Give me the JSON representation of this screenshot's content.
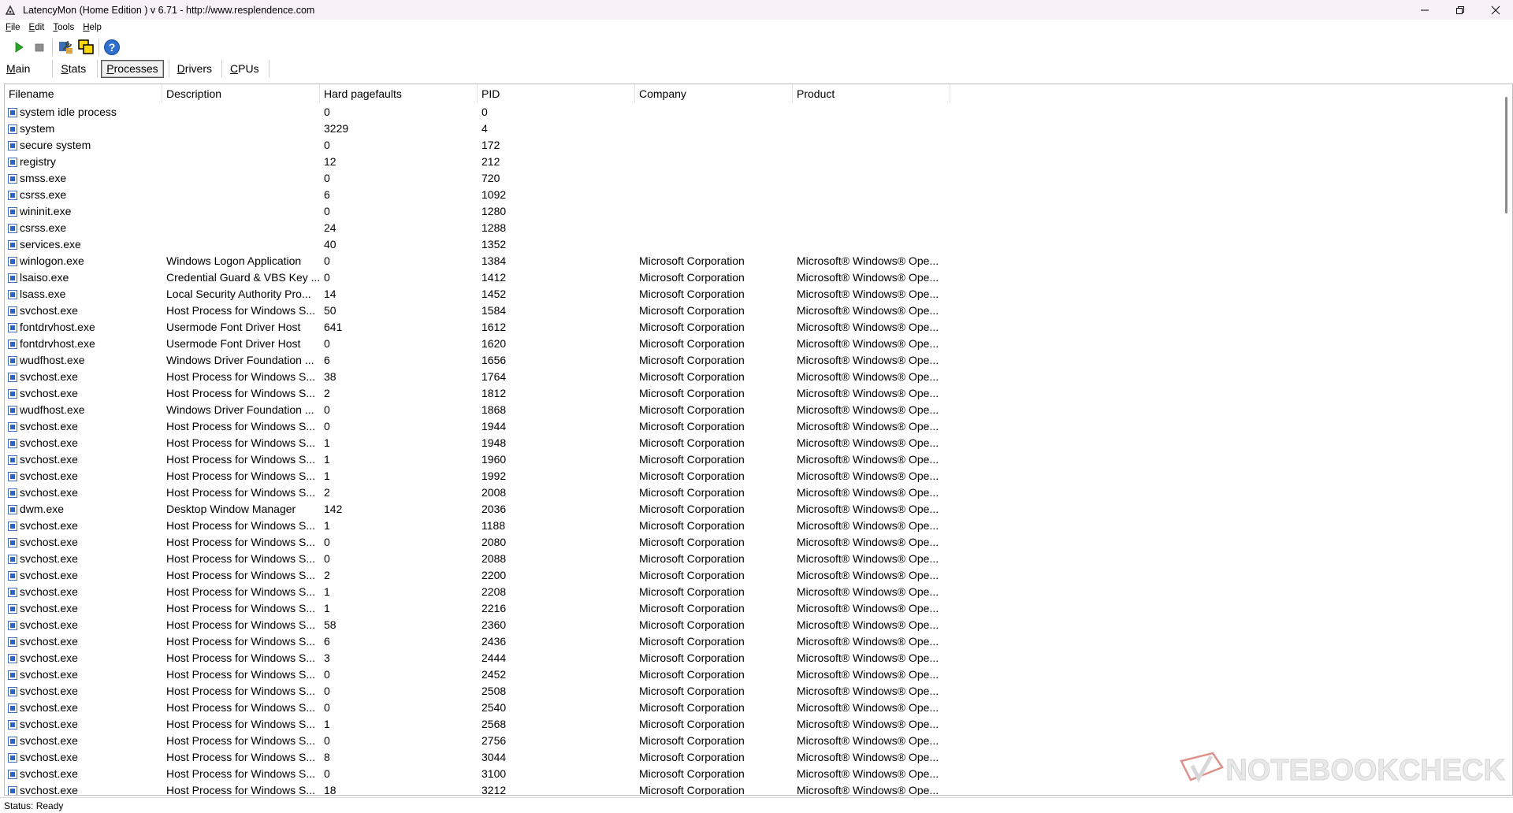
{
  "window": {
    "title": "LatencyMon  (Home Edition )  v 6.71 - http://www.resplendence.com"
  },
  "menu": [
    {
      "label": "File",
      "underline": "F",
      "rest": "ile"
    },
    {
      "label": "Edit",
      "underline": "E",
      "rest": "dit"
    },
    {
      "label": "Tools",
      "underline": "T",
      "rest": "ools"
    },
    {
      "label": "Help",
      "underline": "H",
      "rest": "elp"
    }
  ],
  "toolbar": {
    "icons": [
      "play-icon",
      "stop-icon",
      "wrench-icon",
      "windows-icon",
      "help-icon"
    ]
  },
  "tabs": [
    {
      "first": "M",
      "rest": "ain",
      "active": false
    },
    {
      "first": "S",
      "rest": "tats",
      "active": false
    },
    {
      "first": "P",
      "rest": "rocesses",
      "active": true
    },
    {
      "first": "D",
      "rest": "rivers",
      "active": false
    },
    {
      "first": "C",
      "rest": "PUs",
      "active": false
    }
  ],
  "table": {
    "columns": [
      "Filename",
      "Description",
      "Hard pagefaults",
      "PID",
      "Company",
      "Product"
    ],
    "rows": [
      [
        "system idle process",
        "",
        "0",
        "0",
        "",
        ""
      ],
      [
        "system",
        "",
        "3229",
        "4",
        "",
        ""
      ],
      [
        "secure system",
        "",
        "0",
        "172",
        "",
        ""
      ],
      [
        "registry",
        "",
        "12",
        "212",
        "",
        ""
      ],
      [
        "smss.exe",
        "",
        "0",
        "720",
        "",
        ""
      ],
      [
        "csrss.exe",
        "",
        "6",
        "1092",
        "",
        ""
      ],
      [
        "wininit.exe",
        "",
        "0",
        "1280",
        "",
        ""
      ],
      [
        "csrss.exe",
        "",
        "24",
        "1288",
        "",
        ""
      ],
      [
        "services.exe",
        "",
        "40",
        "1352",
        "",
        ""
      ],
      [
        "winlogon.exe",
        "Windows Logon Application",
        "0",
        "1384",
        "Microsoft Corporation",
        "Microsoft® Windows® Ope..."
      ],
      [
        "lsaiso.exe",
        "Credential Guard & VBS Key ...",
        "0",
        "1412",
        "Microsoft Corporation",
        "Microsoft® Windows® Ope..."
      ],
      [
        "lsass.exe",
        "Local Security Authority Pro...",
        "14",
        "1452",
        "Microsoft Corporation",
        "Microsoft® Windows® Ope..."
      ],
      [
        "svchost.exe",
        "Host Process for Windows S...",
        "50",
        "1584",
        "Microsoft Corporation",
        "Microsoft® Windows® Ope..."
      ],
      [
        "fontdrvhost.exe",
        "Usermode Font Driver Host",
        "641",
        "1612",
        "Microsoft Corporation",
        "Microsoft® Windows® Ope..."
      ],
      [
        "fontdrvhost.exe",
        "Usermode Font Driver Host",
        "0",
        "1620",
        "Microsoft Corporation",
        "Microsoft® Windows® Ope..."
      ],
      [
        "wudfhost.exe",
        "Windows Driver Foundation ...",
        "6",
        "1656",
        "Microsoft Corporation",
        "Microsoft® Windows® Ope..."
      ],
      [
        "svchost.exe",
        "Host Process for Windows S...",
        "38",
        "1764",
        "Microsoft Corporation",
        "Microsoft® Windows® Ope..."
      ],
      [
        "svchost.exe",
        "Host Process for Windows S...",
        "2",
        "1812",
        "Microsoft Corporation",
        "Microsoft® Windows® Ope..."
      ],
      [
        "wudfhost.exe",
        "Windows Driver Foundation ...",
        "0",
        "1868",
        "Microsoft Corporation",
        "Microsoft® Windows® Ope..."
      ],
      [
        "svchost.exe",
        "Host Process for Windows S...",
        "0",
        "1944",
        "Microsoft Corporation",
        "Microsoft® Windows® Ope..."
      ],
      [
        "svchost.exe",
        "Host Process for Windows S...",
        "1",
        "1948",
        "Microsoft Corporation",
        "Microsoft® Windows® Ope..."
      ],
      [
        "svchost.exe",
        "Host Process for Windows S...",
        "1",
        "1960",
        "Microsoft Corporation",
        "Microsoft® Windows® Ope..."
      ],
      [
        "svchost.exe",
        "Host Process for Windows S...",
        "1",
        "1992",
        "Microsoft Corporation",
        "Microsoft® Windows® Ope..."
      ],
      [
        "svchost.exe",
        "Host Process for Windows S...",
        "2",
        "2008",
        "Microsoft Corporation",
        "Microsoft® Windows® Ope..."
      ],
      [
        "dwm.exe",
        "Desktop Window Manager",
        "142",
        "2036",
        "Microsoft Corporation",
        "Microsoft® Windows® Ope..."
      ],
      [
        "svchost.exe",
        "Host Process for Windows S...",
        "1",
        "1188",
        "Microsoft Corporation",
        "Microsoft® Windows® Ope..."
      ],
      [
        "svchost.exe",
        "Host Process for Windows S...",
        "0",
        "2080",
        "Microsoft Corporation",
        "Microsoft® Windows® Ope..."
      ],
      [
        "svchost.exe",
        "Host Process for Windows S...",
        "0",
        "2088",
        "Microsoft Corporation",
        "Microsoft® Windows® Ope..."
      ],
      [
        "svchost.exe",
        "Host Process for Windows S...",
        "2",
        "2200",
        "Microsoft Corporation",
        "Microsoft® Windows® Ope..."
      ],
      [
        "svchost.exe",
        "Host Process for Windows S...",
        "1",
        "2208",
        "Microsoft Corporation",
        "Microsoft® Windows® Ope..."
      ],
      [
        "svchost.exe",
        "Host Process for Windows S...",
        "1",
        "2216",
        "Microsoft Corporation",
        "Microsoft® Windows® Ope..."
      ],
      [
        "svchost.exe",
        "Host Process for Windows S...",
        "58",
        "2360",
        "Microsoft Corporation",
        "Microsoft® Windows® Ope..."
      ],
      [
        "svchost.exe",
        "Host Process for Windows S...",
        "6",
        "2436",
        "Microsoft Corporation",
        "Microsoft® Windows® Ope..."
      ],
      [
        "svchost.exe",
        "Host Process for Windows S...",
        "3",
        "2444",
        "Microsoft Corporation",
        "Microsoft® Windows® Ope..."
      ],
      [
        "svchost.exe",
        "Host Process for Windows S...",
        "0",
        "2452",
        "Microsoft Corporation",
        "Microsoft® Windows® Ope..."
      ],
      [
        "svchost.exe",
        "Host Process for Windows S...",
        "0",
        "2508",
        "Microsoft Corporation",
        "Microsoft® Windows® Ope..."
      ],
      [
        "svchost.exe",
        "Host Process for Windows S...",
        "0",
        "2540",
        "Microsoft Corporation",
        "Microsoft® Windows® Ope..."
      ],
      [
        "svchost.exe",
        "Host Process for Windows S...",
        "1",
        "2568",
        "Microsoft Corporation",
        "Microsoft® Windows® Ope..."
      ],
      [
        "svchost.exe",
        "Host Process for Windows S...",
        "0",
        "2756",
        "Microsoft Corporation",
        "Microsoft® Windows® Ope..."
      ],
      [
        "svchost.exe",
        "Host Process for Windows S...",
        "8",
        "3044",
        "Microsoft Corporation",
        "Microsoft® Windows® Ope..."
      ],
      [
        "svchost.exe",
        "Host Process for Windows S...",
        "0",
        "3100",
        "Microsoft Corporation",
        "Microsoft® Windows® Ope..."
      ],
      [
        "svchost.exe",
        "Host Process for Windows S...",
        "18",
        "3212",
        "Microsoft Corporation",
        "Microsoft® Windows® Ope..."
      ]
    ]
  },
  "watermark": "NOTEBOOKCHECK",
  "status": "Status: Ready",
  "colors": {
    "titlebar_bg": "#f7f0f5",
    "icon_blue": "#2b63c6",
    "play_green": "#2aa52a",
    "watermark": "#c0392b"
  }
}
